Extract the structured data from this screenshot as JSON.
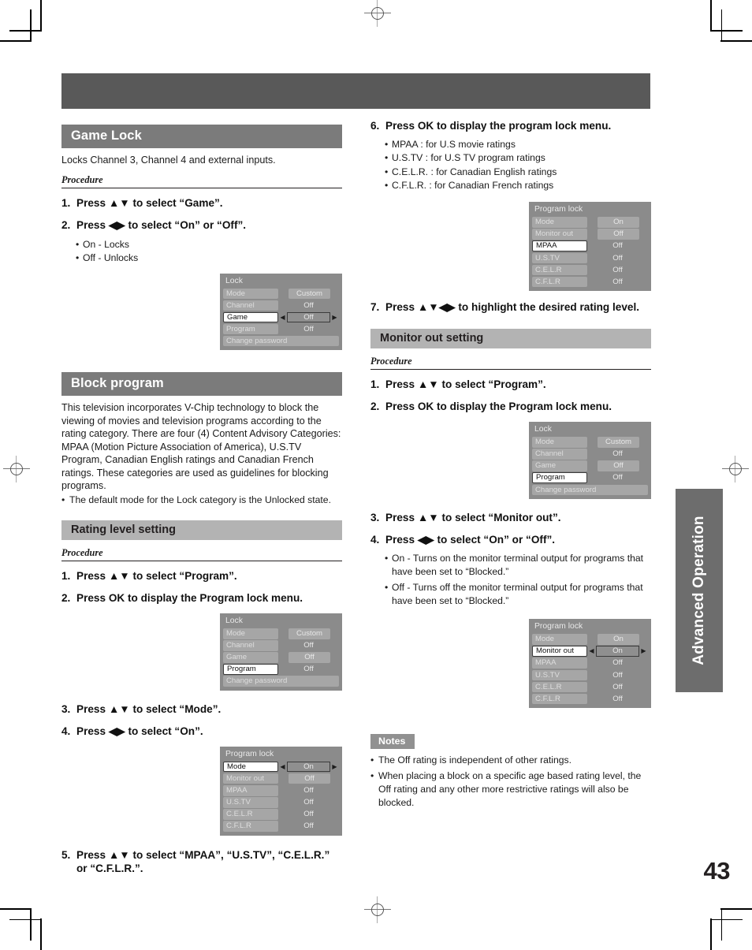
{
  "page": {
    "number": "43",
    "side_tab": "Advanced Operation"
  },
  "left": {
    "game_lock": {
      "heading": "Game Lock",
      "intro": "Locks Channel 3, Channel 4 and external inputs.",
      "procedure_label": "Procedure",
      "steps": [
        {
          "num": "1.",
          "text": "Press ▲▼ to select “Game”."
        },
        {
          "num": "2.",
          "text": "Press ◀▶ to select “On” or “Off”."
        }
      ],
      "bullets": [
        "On - Locks",
        "Off - Unlocks"
      ],
      "osd": {
        "title": "Lock",
        "rows": [
          {
            "label": "Mode",
            "value": "Custom",
            "style": "value-box",
            "selected": false,
            "arrows": false
          },
          {
            "label": "Channel",
            "value": "Off",
            "style": "value-plain",
            "selected": false,
            "arrows": false
          },
          {
            "label": "Game",
            "value": "Off",
            "style": "value-hi",
            "selected": true,
            "arrows": true
          },
          {
            "label": "Program",
            "value": "Off",
            "style": "value-plain",
            "selected": false,
            "arrows": false
          },
          {
            "label": "Change password",
            "value": "",
            "style": "full",
            "selected": false,
            "arrows": false
          }
        ]
      }
    },
    "block_program": {
      "heading": "Block program",
      "paragraph": "This television incorporates V-Chip technology to block the viewing of movies and television programs according to the rating category. There are four (4) Content Advisory Categories: MPAA (Motion Picture Association of America), U.S.TV Program, Canadian English ratings and Canadian French ratings. These categories are used as guidelines for blocking programs.",
      "note": "The default mode for the Lock category is the Unlocked state."
    },
    "rating_level": {
      "heading": "Rating level setting",
      "procedure_label": "Procedure",
      "steps_a": [
        {
          "num": "1.",
          "text": "Press ▲▼ to select “Program”."
        },
        {
          "num": "2.",
          "text": "Press OK to display the Program lock menu."
        }
      ],
      "osd_lock": {
        "title": "Lock",
        "rows": [
          {
            "label": "Mode",
            "value": "Custom",
            "style": "value-box",
            "selected": false,
            "arrows": false
          },
          {
            "label": "Channel",
            "value": "Off",
            "style": "value-plain",
            "selected": false,
            "arrows": false
          },
          {
            "label": "Game",
            "value": "Off",
            "style": "value-box",
            "selected": false,
            "arrows": false
          },
          {
            "label": "Program",
            "value": "Off",
            "style": "value-plain",
            "selected": true,
            "arrows": false
          },
          {
            "label": "Change password",
            "value": "",
            "style": "full",
            "selected": false,
            "arrows": false
          }
        ]
      },
      "steps_b": [
        {
          "num": "3.",
          "text": "Press ▲▼ to select “Mode”."
        },
        {
          "num": "4.",
          "text": "Press ◀▶ to select “On”."
        }
      ],
      "osd_program": {
        "title": "Program lock",
        "rows": [
          {
            "label": "Mode",
            "value": "On",
            "style": "value-hi",
            "selected": true,
            "arrows": true
          },
          {
            "label": "Monitor out",
            "value": "Off",
            "style": "value-box",
            "selected": false,
            "arrows": false
          },
          {
            "label": "MPAA",
            "value": "Off",
            "style": "value-plain",
            "selected": false,
            "arrows": false
          },
          {
            "label": "U.S.TV",
            "value": "Off",
            "style": "value-plain",
            "selected": false,
            "arrows": false
          },
          {
            "label": "C.E.L.R",
            "value": "Off",
            "style": "value-plain",
            "selected": false,
            "arrows": false
          },
          {
            "label": "C.F.L.R",
            "value": "Off",
            "style": "value-plain",
            "selected": false,
            "arrows": false
          }
        ]
      },
      "step5": {
        "num": "5.",
        "text": "Press ▲▼ to select “MPAA”, “U.S.TV”, “C.E.L.R.” or “C.F.L.R.”."
      }
    }
  },
  "right": {
    "step6": {
      "num": "6.",
      "text": "Press OK to display the program lock menu."
    },
    "step6_bullets": [
      "MPAA : for U.S movie ratings",
      "U.S.TV : for U.S TV program ratings",
      "C.E.L.R. : for Canadian English ratings",
      "C.F.L.R. : for Canadian French ratings"
    ],
    "osd_program_top": {
      "title": "Program lock",
      "rows": [
        {
          "label": "Mode",
          "value": "On",
          "style": "value-box",
          "selected": false,
          "arrows": false
        },
        {
          "label": "Monitor out",
          "value": "Off",
          "style": "value-box",
          "selected": false,
          "arrows": false
        },
        {
          "label": "MPAA",
          "value": "Off",
          "style": "value-plain",
          "selected": true,
          "arrows": false
        },
        {
          "label": "U.S.TV",
          "value": "Off",
          "style": "value-plain",
          "selected": false,
          "arrows": false
        },
        {
          "label": "C.E.L.R",
          "value": "Off",
          "style": "value-plain",
          "selected": false,
          "arrows": false
        },
        {
          "label": "C.F.L.R",
          "value": "Off",
          "style": "value-plain",
          "selected": false,
          "arrows": false
        }
      ]
    },
    "step7": {
      "num": "7.",
      "text": "Press ▲▼◀▶ to highlight the desired rating level."
    },
    "monitor_out": {
      "heading": "Monitor out setting",
      "procedure_label": "Procedure",
      "steps_a": [
        {
          "num": "1.",
          "text": "Press ▲▼ to select “Program”."
        },
        {
          "num": "2.",
          "text": "Press OK to display the Program lock menu."
        }
      ],
      "osd_lock": {
        "title": "Lock",
        "rows": [
          {
            "label": "Mode",
            "value": "Custom",
            "style": "value-box",
            "selected": false,
            "arrows": false
          },
          {
            "label": "Channel",
            "value": "Off",
            "style": "value-plain",
            "selected": false,
            "arrows": false
          },
          {
            "label": "Game",
            "value": "Off",
            "style": "value-box",
            "selected": false,
            "arrows": false
          },
          {
            "label": "Program",
            "value": "Off",
            "style": "value-plain",
            "selected": true,
            "arrows": false
          },
          {
            "label": "Change password",
            "value": "",
            "style": "full",
            "selected": false,
            "arrows": false
          }
        ]
      },
      "steps_b": [
        {
          "num": "3.",
          "text": "Press ▲▼ to select “Monitor out”."
        },
        {
          "num": "4.",
          "text": "Press ◀▶ to select “On” or “Off”."
        }
      ],
      "bullets": [
        "On - Turns on the monitor terminal output for programs that have been set to “Blocked.”",
        "Off - Turns off the monitor terminal output for programs that have been set to “Blocked.”"
      ],
      "osd_program": {
        "title": "Program lock",
        "rows": [
          {
            "label": "Mode",
            "value": "On",
            "style": "value-box",
            "selected": false,
            "arrows": false
          },
          {
            "label": "Monitor out",
            "value": "On",
            "style": "value-hi",
            "selected": true,
            "arrows": true
          },
          {
            "label": "MPAA",
            "value": "Off",
            "style": "value-plain",
            "selected": false,
            "arrows": false
          },
          {
            "label": "U.S.TV",
            "value": "Off",
            "style": "value-plain",
            "selected": false,
            "arrows": false
          },
          {
            "label": "C.E.L.R",
            "value": "Off",
            "style": "value-plain",
            "selected": false,
            "arrows": false
          },
          {
            "label": "C.F.L.R",
            "value": "Off",
            "style": "value-plain",
            "selected": false,
            "arrows": false
          }
        ]
      }
    },
    "notes": {
      "title": "Notes",
      "items": [
        "The Off rating is independent of other ratings.",
        "When placing a block on a specific age based rating level, the Off rating and any other more restrictive ratings will also be blocked."
      ]
    }
  },
  "colors": {
    "major_heading_bg": "#7b7b7b",
    "minor_heading_bg": "#b3b3b3",
    "osd_bg": "#8b8b8b",
    "osd_row_bg": "#a6a6a6",
    "top_bar": "#595959",
    "side_tab": "#6d6d6d"
  }
}
